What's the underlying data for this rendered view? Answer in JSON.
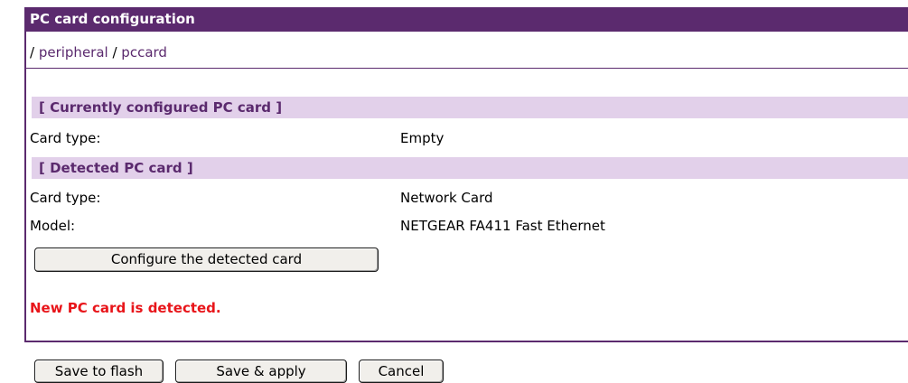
{
  "panel": {
    "title": "PC card configuration",
    "breadcrumb": {
      "sep1": "/ ",
      "link1": "peripheral",
      "sep2": " / ",
      "link2": "pccard"
    }
  },
  "current_section": {
    "header": "[ Currently configured PC card ]",
    "card_type_label": "Card type:",
    "card_type_value": "Empty"
  },
  "detected_section": {
    "header": "[ Detected PC card ]",
    "card_type_label": "Card type:",
    "card_type_value": "Network Card",
    "model_label": "Model:",
    "model_value": "NETGEAR FA411 Fast Ethernet",
    "configure_button": "Configure the detected card"
  },
  "status_message": "New PC card is detected.",
  "colors": {
    "accent": "#5b2a6e",
    "section_bg": "#e2d0ea",
    "status_red": "#e8151a"
  },
  "footer": {
    "save_flash": "Save to flash",
    "save_apply": "Save & apply",
    "cancel": "Cancel"
  }
}
